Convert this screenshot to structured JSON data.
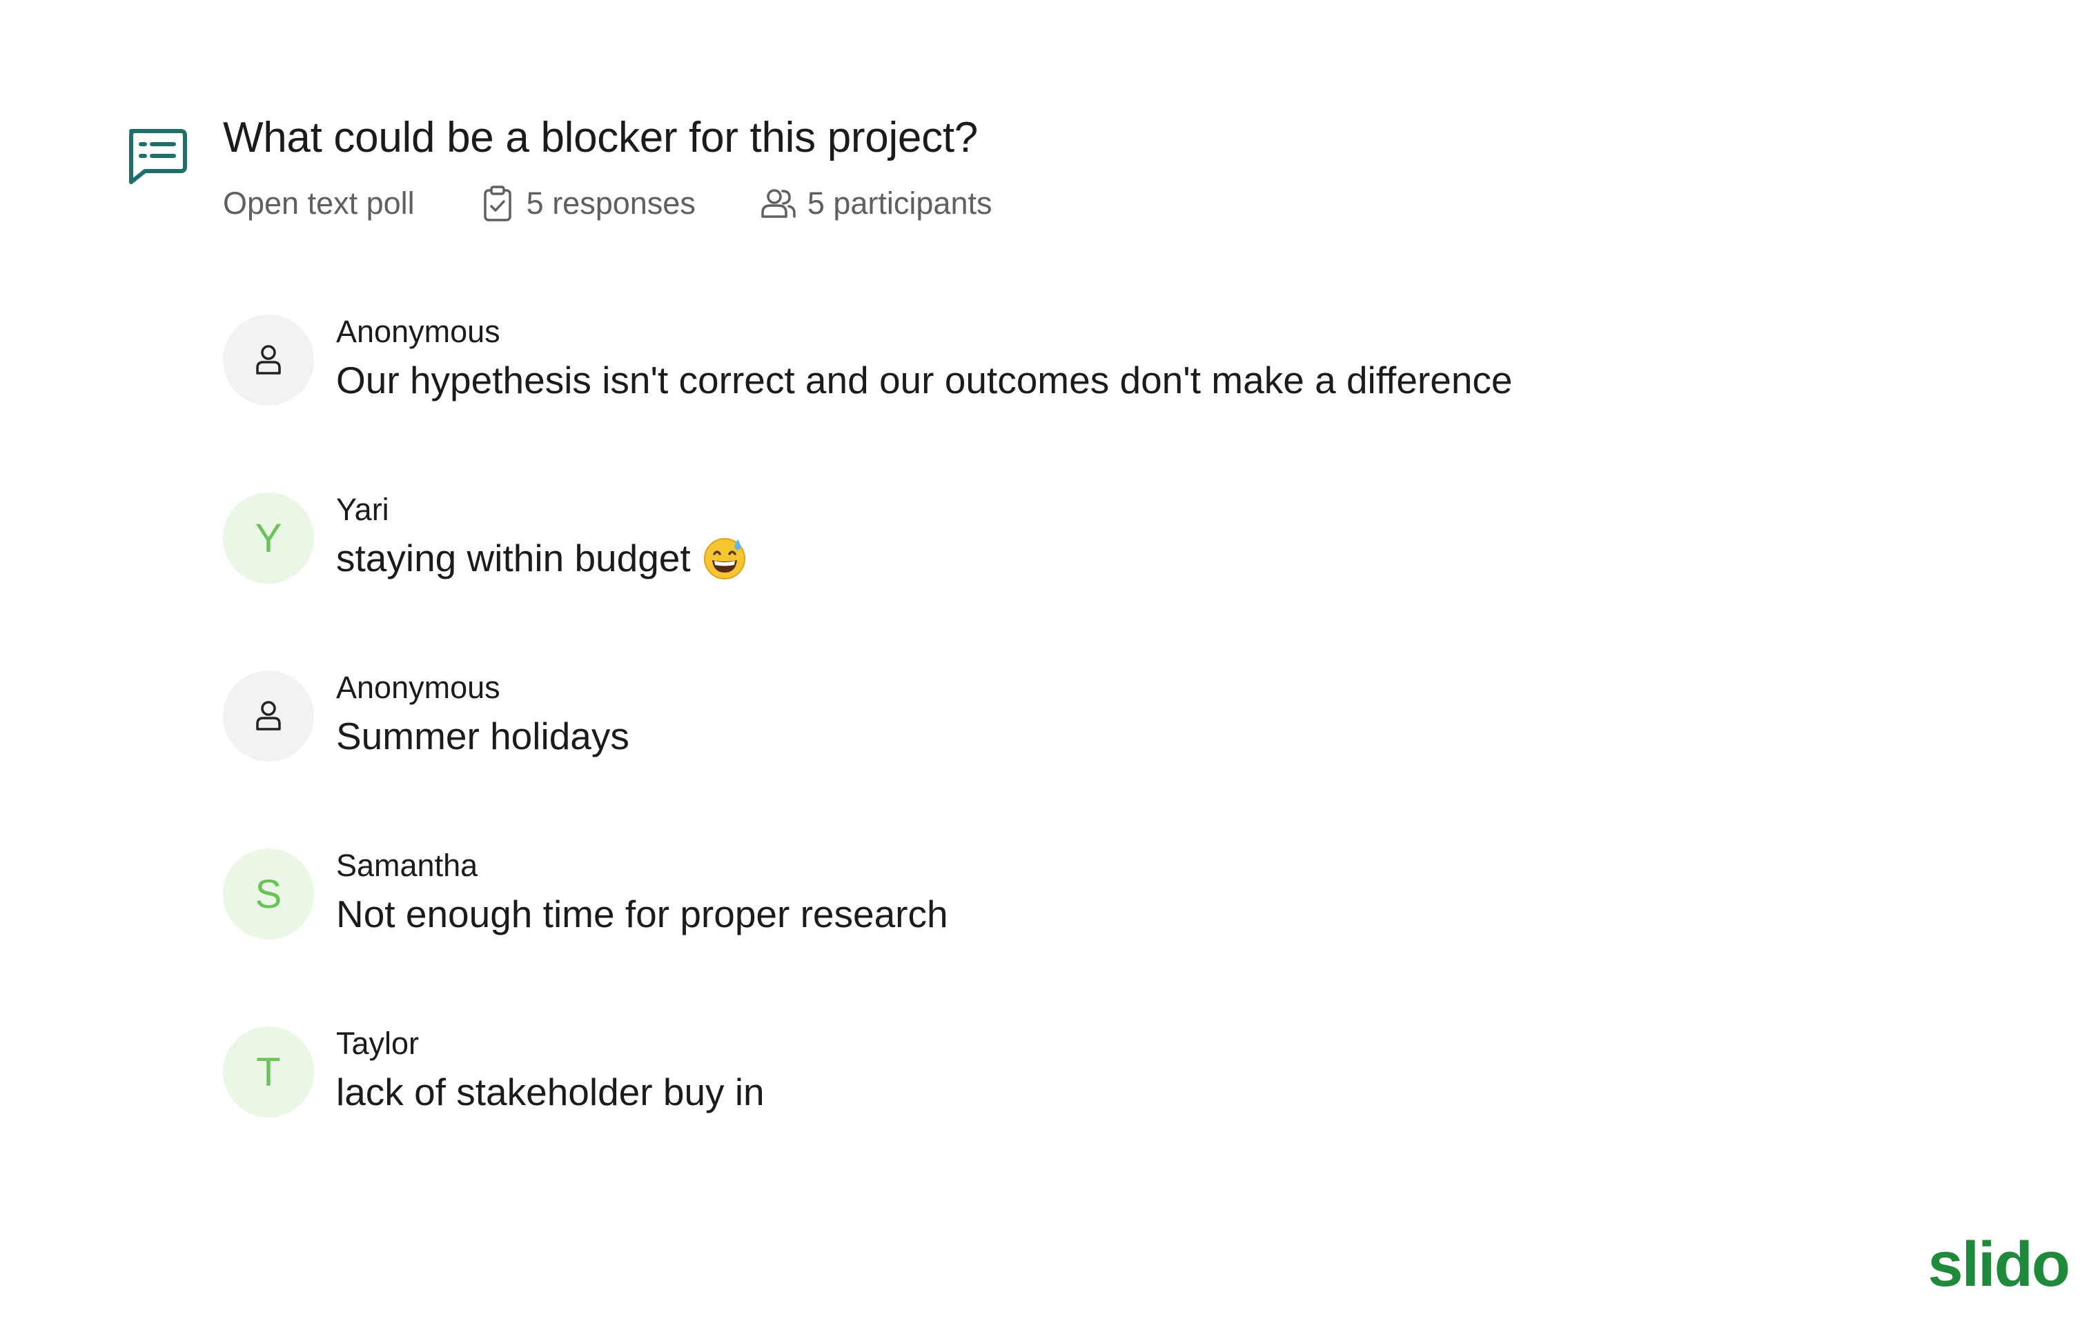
{
  "poll": {
    "icon": "speech-bubble-list-icon",
    "question": "What could be a blocker for this project?",
    "type_label": "Open text poll",
    "responses_label": "5 responses",
    "participants_label": "5 participants"
  },
  "responses": [
    {
      "avatar": "user-icon",
      "author": "Anonymous",
      "text": "Our hypethesis isn't correct and our outcomes don't make a difference"
    },
    {
      "avatar_letter": "Y",
      "author": "Yari",
      "text": "staying within budget",
      "emoji": "grinning-sweat-emoji"
    },
    {
      "avatar": "user-icon",
      "author": "Anonymous",
      "text": "Summer holidays"
    },
    {
      "avatar_letter": "S",
      "author": "Samantha",
      "text": "Not enough time for proper research"
    },
    {
      "avatar_letter": "T",
      "author": "Taylor",
      "text": "lack of stakeholder buy in"
    }
  ],
  "brand": {
    "logo_text": "slido",
    "color": "#1f8a3a"
  },
  "colors": {
    "accent": "#1f6f6a",
    "avatar_letter": "#6cc25a",
    "avatar_letter_bg": "#eaf6e6",
    "avatar_anon_bg": "#f2f2f2"
  }
}
